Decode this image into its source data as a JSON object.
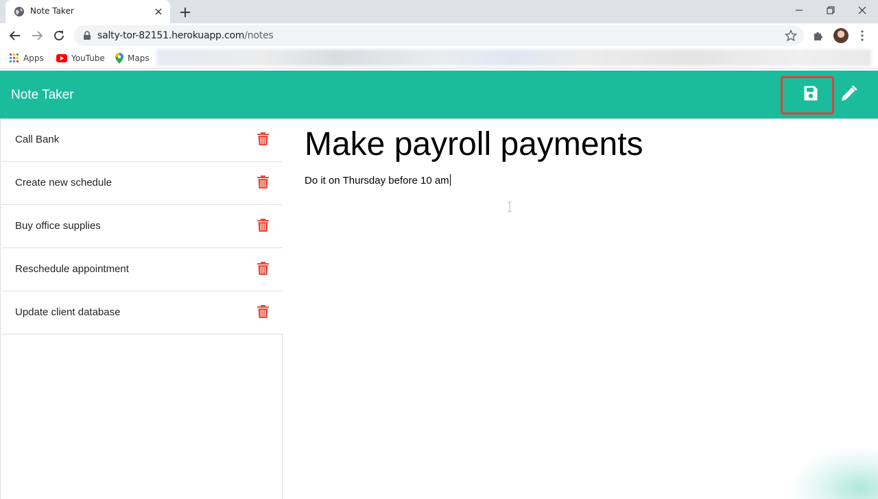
{
  "browser": {
    "tab_title": "Note Taker",
    "url_host": "salty-tor-82151.herokuapp.com",
    "url_path": "/notes",
    "bookmarks": [
      {
        "label": "Apps",
        "icon": "apps-grid-icon"
      },
      {
        "label": "YouTube",
        "icon": "youtube-icon"
      },
      {
        "label": "Maps",
        "icon": "maps-pin-icon"
      }
    ]
  },
  "app": {
    "title": "Note Taker",
    "colors": {
      "header": "#1abc9c",
      "trash": "#e74c3c",
      "highlight": "#e0403a"
    },
    "actions": {
      "save_icon": "save-icon",
      "edit_icon": "pencil-icon"
    }
  },
  "notes": [
    {
      "title": "Call Bank"
    },
    {
      "title": "Create new schedule"
    },
    {
      "title": "Buy office supplies"
    },
    {
      "title": "Reschedule appointment"
    },
    {
      "title": "Update client database"
    }
  ],
  "editor": {
    "title": "Make payroll payments",
    "body": "Do it on Thursday before 10 am"
  }
}
